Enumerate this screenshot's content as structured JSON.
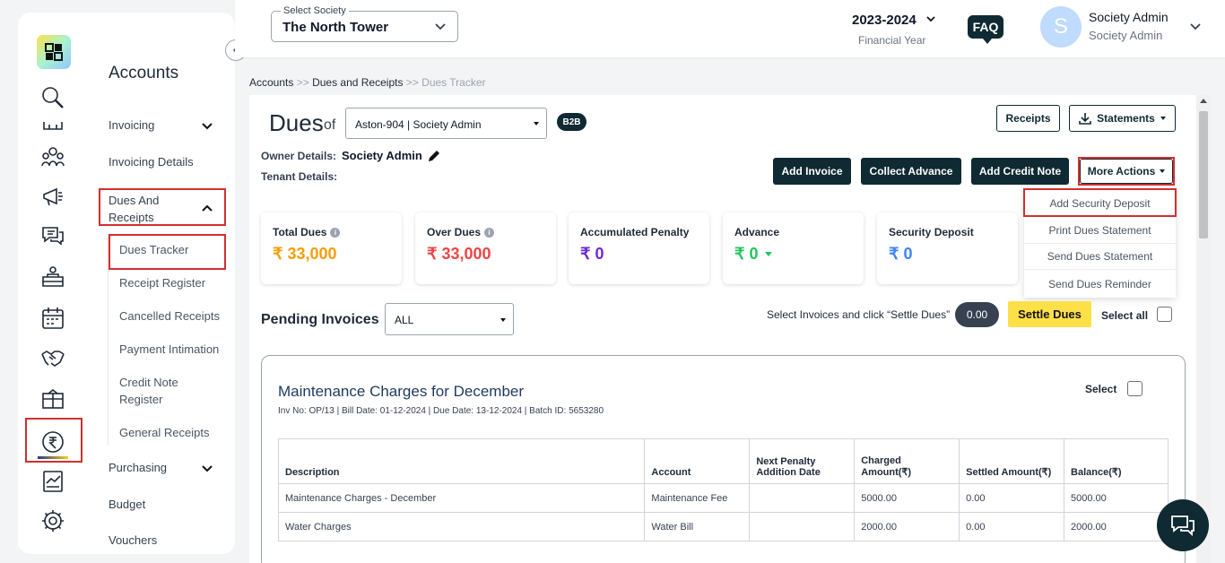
{
  "header": {
    "society_label": "Select Society",
    "society_value": "The North Tower",
    "financial_year": "2023-2024",
    "financial_year_label": "Financial Year",
    "faq": "FAQ",
    "avatar_letter": "S",
    "user_name": "Society Admin",
    "user_role": "Society Admin"
  },
  "sidebar": {
    "title": "Accounts",
    "items": [
      {
        "label": "Invoicing"
      },
      {
        "label": "Invoicing Details"
      },
      {
        "label": "Dues And Receipts"
      },
      {
        "label": "Purchasing"
      },
      {
        "label": "Budget"
      },
      {
        "label": "Vouchers"
      }
    ],
    "subitems": [
      {
        "label": "Dues Tracker"
      },
      {
        "label": "Receipt Register"
      },
      {
        "label": "Cancelled Receipts"
      },
      {
        "label": "Payment Intimation"
      },
      {
        "label": "Credit Note Register"
      },
      {
        "label": "General Receipts"
      }
    ]
  },
  "breadcrumb": {
    "a": "Accounts",
    "sep": ">>",
    "b": "Dues and Receipts",
    "c": "Dues Tracker"
  },
  "dues": {
    "title": "Dues",
    "of": "of",
    "unit": "Aston-904 | Society Admin",
    "badge": "B2B",
    "owner_label": "Owner Details:",
    "owner_value": "Society Admin",
    "tenant_label": "Tenant Details:"
  },
  "buttons": {
    "receipts": "Receipts",
    "statements": "Statements",
    "add_invoice": "Add Invoice",
    "collect_advance": "Collect Advance",
    "add_credit_note": "Add Credit Note",
    "more_actions": "More Actions"
  },
  "more_menu": [
    "Add Security Deposit",
    "Print Dues Statement",
    "Send Dues Statement",
    "Send Dues Reminder"
  ],
  "cards": [
    {
      "label": "Total Dues",
      "value": "₹ 33,000",
      "color": "#f59e0b"
    },
    {
      "label": "Over Dues",
      "value": "₹ 33,000",
      "color": "#ef4444"
    },
    {
      "label": "Accumulated Penalty",
      "value": "₹ 0",
      "color": "#6d28d9"
    },
    {
      "label": "Advance",
      "value": "₹ 0",
      "color": "#22c55e"
    },
    {
      "label": "Security Deposit",
      "value": "₹ 0",
      "color": "#3b82f6"
    }
  ],
  "pending": {
    "title": "Pending Invoices",
    "filter": "ALL",
    "hint": "Select Invoices and click “Settle Dues”",
    "amount": "0.00",
    "settle": "Settle Dues",
    "select_all": "Select all"
  },
  "invoice": {
    "title": "Maintenance Charges for December",
    "meta": "Inv No: OP/13 | Bill Date: 01-12-2024 | Due Date: 13-12-2024 | Batch ID: 5653280",
    "select": "Select",
    "columns": [
      "Description",
      "Account",
      "Next Penalty Addition Date",
      "Charged Amount(₹)",
      "Settled Amount(₹)",
      "Balance(₹)"
    ],
    "rows": [
      [
        "Maintenance Charges - December",
        "Maintenance Fee",
        "",
        "5000.00",
        "0.00",
        "5000.00"
      ],
      [
        "Water Charges",
        "Water Bill",
        "",
        "2000.00",
        "0.00",
        "2000.00"
      ]
    ]
  }
}
